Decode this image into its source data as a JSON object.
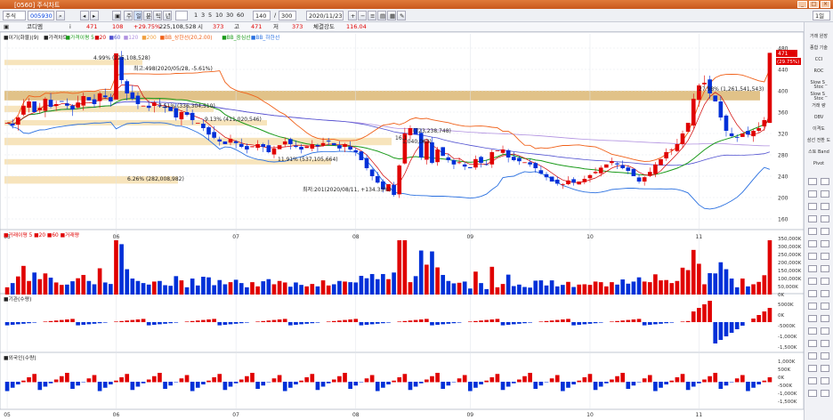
{
  "window": {
    "title": "[0560] 주식차트",
    "buttons": [
      "_",
      "□",
      "×"
    ]
  },
  "toolbar": {
    "market": "주식",
    "code": "005930",
    "tick_units": [
      "주",
      "일",
      "분",
      "틱",
      "년"
    ],
    "intervals": [
      "1",
      "3",
      "5",
      "10",
      "30",
      "60"
    ],
    "count": "140",
    "total": "300",
    "date": "2020/11/23",
    "mode": "1일"
  },
  "quote": {
    "label": "코디엠",
    "price_label": "i",
    "price": "471",
    "change": "108",
    "change_pct": "+29.75%",
    "volume": "225,108,528",
    "open_label": "시",
    "open": "373",
    "high_label": "고",
    "high": "471",
    "low_label": "저",
    "low": "373",
    "strength_label": "체결강도",
    "strength": "116.04"
  },
  "chart_data": [
    {
      "type": "candlestick",
      "pane": "price",
      "header": [
        "■이기(화물)(9)",
        "■가격차트",
        "■가격이평 5",
        "■20",
        "■60",
        "■120",
        "■200",
        "■BB_상한선(20,2.00)",
        "■BB_중심선",
        "■BB_하한선"
      ],
      "y_ticks": [
        160,
        200,
        240,
        280,
        320,
        360,
        400,
        440,
        480
      ],
      "ylim": [
        140,
        500
      ],
      "x_ticks": [
        "05",
        "06",
        "07",
        "08",
        "09",
        "10",
        "11"
      ],
      "current_price_label": "471",
      "current_change_label": "(29.75%)",
      "annotations": [
        {
          "text": "4.99% (225,108,528)",
          "y": 458
        },
        {
          "text": "최고:498(2020/05/28, -5.61%)",
          "y": 438
        },
        {
          "text": "27.98% (1,261,541,543)",
          "y": 400
        },
        {
          "text": "7.51% (336,304,510)",
          "y": 368
        },
        {
          "text": "9.13% (411,020,546)",
          "y": 343
        },
        {
          "text": "16.1",
          "y": 308
        },
        {
          "text": "(723,238,748)",
          "y": 322
        },
        {
          "text": "1,040,063)",
          "y": 302
        },
        {
          "text": "11.91% (537,105,664)",
          "y": 268
        },
        {
          "text": "6.26% (282,008,982)",
          "y": 232
        },
        {
          "text": "최저:201(2020/08/11, +134.33%)",
          "y": 212
        }
      ],
      "close": [
        340,
        335,
        350,
        372,
        380,
        360,
        368,
        385,
        370,
        375,
        380,
        372,
        365,
        378,
        390,
        382,
        375,
        395,
        388,
        380,
        470,
        420,
        395,
        385,
        375,
        372,
        368,
        378,
        372,
        368,
        362,
        350,
        360,
        355,
        345,
        340,
        330,
        318,
        312,
        305,
        300,
        310,
        302,
        295,
        290,
        296,
        300,
        295,
        285,
        292,
        298,
        305,
        300,
        295,
        290,
        296,
        300,
        296,
        302,
        305,
        298,
        292,
        300,
        290,
        285,
        270,
        255,
        240,
        228,
        215,
        225,
        205,
        260,
        320,
        330,
        318,
        275,
        305,
        265,
        290,
        278,
        270,
        262,
        266,
        258,
        255,
        272,
        265,
        262,
        285,
        288,
        290,
        275,
        270,
        268,
        266,
        262,
        255,
        245,
        238,
        230,
        226,
        225,
        232,
        228,
        230,
        235,
        242,
        248,
        256,
        262,
        268,
        262,
        255,
        250,
        240,
        230,
        238,
        248,
        262,
        272,
        285,
        290,
        300,
        320,
        340,
        385,
        410,
        415,
        395,
        380,
        350,
        325,
        315,
        312,
        320,
        318,
        325,
        330,
        345,
        471
      ],
      "volume_ticks": [
        "350,000K",
        "300,000K",
        "250,000K",
        "200,000K",
        "150,000K",
        "100,000K",
        "50,000K",
        "0K"
      ],
      "institution_ticks": [
        "5000K",
        "0K",
        "-5000K",
        "-1,000K",
        "-1,500K"
      ],
      "foreign_ticks": [
        "1,000K",
        "500K",
        "0K",
        "-500K",
        "-1,000K",
        "-1,500K"
      ]
    }
  ],
  "panes": {
    "volume": {
      "header": [
        "■거래이평 5",
        "■20",
        "■60",
        "■거래량"
      ]
    },
    "institution": {
      "header": [
        "■기관(수량)"
      ]
    },
    "foreign": {
      "header": [
        "■외국인(수량)"
      ]
    }
  },
  "right_panel": {
    "items": [
      "거래\n원장",
      "종합\n기술",
      "CCI",
      "ROC",
      "Slow\nS_\nStoc",
      "Slow\nS_\nStoc",
      "거래\n량",
      "OBV",
      "이격도",
      "삼선\n전환\n도",
      "스토\nBand",
      "Pivot"
    ]
  },
  "colors": {
    "up": "#e00000",
    "down": "#0030d8",
    "ma5": "#d00000",
    "ma20": "#1a9a1a",
    "ma60": "#5050d0",
    "ma120": "#b090e0",
    "ma200": "#f0a040",
    "bb_upper": "#f06018",
    "bb_lower": "#2a70e0",
    "highlight_band": "#f4d9a0"
  }
}
